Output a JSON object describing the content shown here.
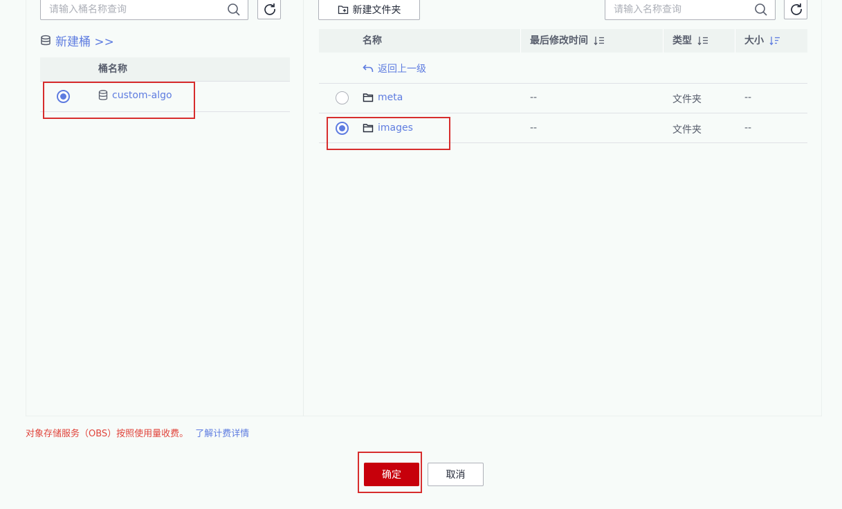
{
  "left": {
    "search_placeholder": "请输入桶名称查询",
    "new_bucket_label": "新建桶 >>",
    "table_header_name": "桶名称",
    "buckets": [
      {
        "name": "custom-algo",
        "selected": true
      }
    ]
  },
  "right": {
    "new_folder_label": "新建文件夹",
    "search_placeholder": "请输入名称查询",
    "headers": {
      "name": "名称",
      "modified": "最后修改时间",
      "type": "类型",
      "size": "大小"
    },
    "back_label": "返回上一级",
    "rows": [
      {
        "name": "meta",
        "modified": "--",
        "type": "文件夹",
        "size": "--",
        "selected": false
      },
      {
        "name": "images",
        "modified": "--",
        "type": "文件夹",
        "size": "--",
        "selected": true
      }
    ]
  },
  "footer": {
    "notice": "对象存储服务（OBS）按照使用量收费。",
    "notice_link": "了解计费详情",
    "confirm_label": "确定",
    "cancel_label": "取消"
  },
  "colors": {
    "accent": "#5e7ce0",
    "primary_button": "#c7000b",
    "highlight_box": "#d72c2c",
    "notice_text": "#e0433a"
  }
}
